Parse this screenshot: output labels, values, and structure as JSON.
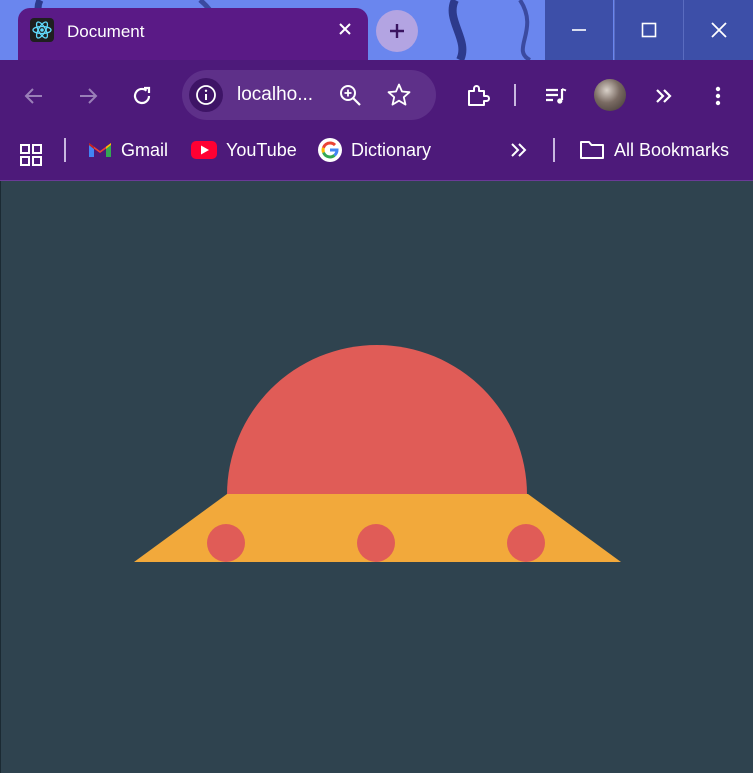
{
  "browser": {
    "tab": {
      "title": "Document",
      "favicon": "react-icon"
    },
    "new_tab_icon": "plus-icon",
    "window_controls": [
      "minimize-icon",
      "maximize-icon",
      "close-icon"
    ],
    "address_bar": {
      "url": "localho..."
    },
    "toolbar_icons": [
      "back-icon",
      "forward-icon",
      "reload-icon",
      "site-info-icon",
      "zoom-icon",
      "bookmark-star-icon",
      "extensions-icon",
      "media-control-icon",
      "profile-avatar",
      "more-tools-icon",
      "menu-icon"
    ]
  },
  "bookmarks": {
    "items": [
      {
        "label": "Gmail",
        "icon": "gmail-icon"
      },
      {
        "label": "YouTube",
        "icon": "youtube-icon"
      },
      {
        "label": "Dictionary",
        "icon": "google-icon"
      }
    ],
    "all_bookmarks": "All Bookmarks"
  },
  "page": {
    "background": "#2f434f",
    "ufo": {
      "dome_color": "#e05c57",
      "base_color": "#f2a93b",
      "light_color": "#e05c57",
      "lights_count": 3
    }
  },
  "colors": {
    "titlebar": "#6a86ee",
    "tab_active": "#5a1a86",
    "toolbar": "#4d1a7a",
    "omnibox": "#5e3089",
    "window_controls": "#3d4fa8"
  }
}
